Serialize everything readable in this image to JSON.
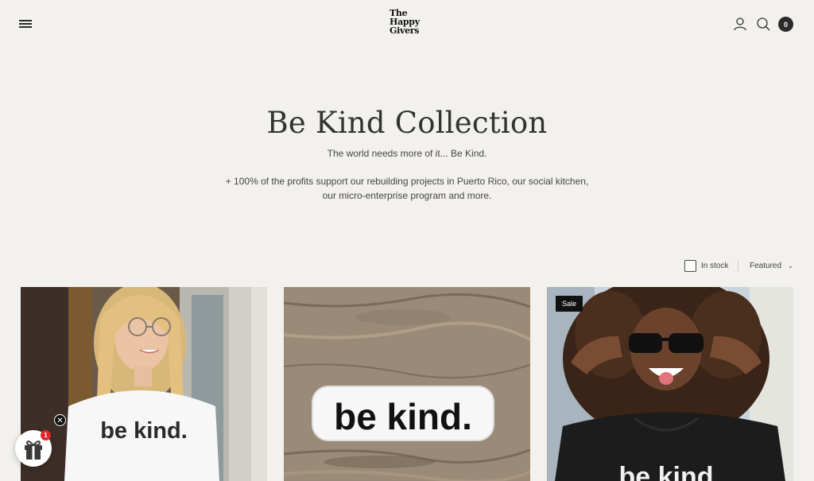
{
  "header": {
    "logo_lines": [
      "The",
      "Happy",
      "Givers"
    ],
    "cart_count": "0",
    "icons": [
      "menu-icon",
      "account-icon",
      "search-icon",
      "cart-icon"
    ]
  },
  "hero": {
    "title": "Be Kind Collection",
    "tagline": "The world needs more of it... Be Kind.",
    "description_line1": "+ 100% of the profits support our rebuilding projects in Puerto Rico, our social kitchen,",
    "description_line2": "our micro-enterprise program and more."
  },
  "filters": {
    "in_stock_label": "In stock",
    "in_stock_checked": false,
    "sort_value": "Featured"
  },
  "products": [
    {
      "image_text": "be kind.",
      "badge": ""
    },
    {
      "image_text": "be kind.",
      "badge": ""
    },
    {
      "image_text": "be kind",
      "badge": "Sale"
    }
  ],
  "gift_widget": {
    "count": "1",
    "close_symbol": "✕"
  },
  "colors": {
    "background": "#f2f1ed",
    "text": "#2b2b2b",
    "badge_dark": "#111111",
    "notification_red": "#e0262b"
  }
}
